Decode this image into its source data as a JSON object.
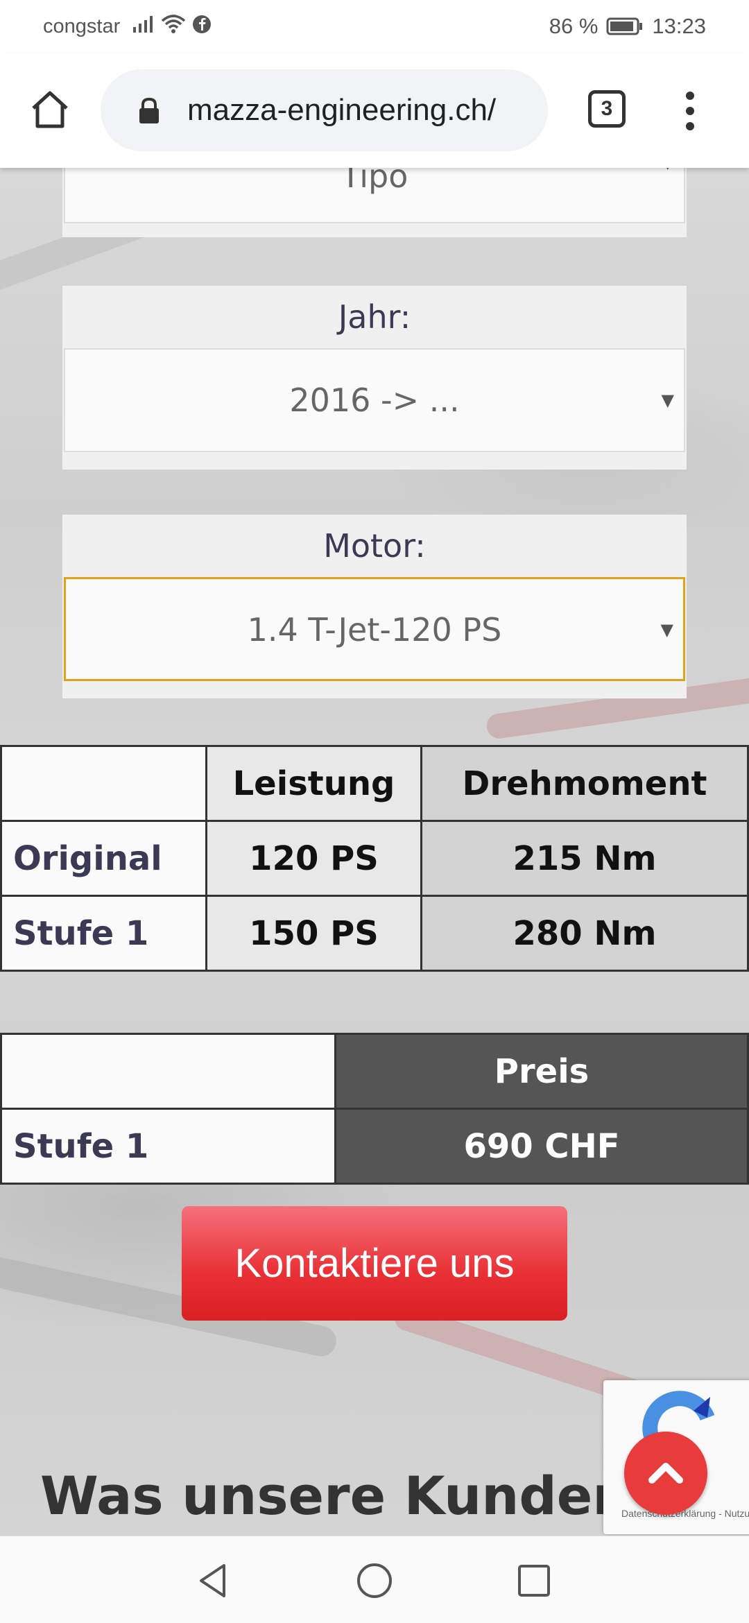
{
  "status_bar": {
    "carrier": "congstar",
    "battery": "86 %",
    "time": "13:23"
  },
  "browser": {
    "url": "mazza-engineering.ch/",
    "tab_count": "3"
  },
  "form": {
    "model_partial": "Tipo",
    "year_label": "Jahr:",
    "year_value": "2016 -> ...",
    "engine_label": "Motor:",
    "engine_value": "1.4 T-Jet-120 PS"
  },
  "specs_table": {
    "headers": [
      "",
      "Leistung",
      "Drehmoment"
    ],
    "rows": [
      {
        "label": "Original",
        "power": "120 PS",
        "torque": "215 Nm"
      },
      {
        "label": "Stufe 1",
        "power": "150 PS",
        "torque": "280 Nm"
      }
    ]
  },
  "price_table": {
    "header": "Preis",
    "row_label": "Stufe 1",
    "price": "690 CHF"
  },
  "cta": {
    "contact_label": "Kontaktiere uns"
  },
  "section": {
    "heading": "Was unsere Kunden über"
  },
  "recaptcha": {
    "text": "Datenschutzerklärung - Nutzungsbedingungen"
  },
  "colors": {
    "accent_red": "#e82f34",
    "label_navy": "#3b3954",
    "focus_orange": "#e0a31a",
    "price_dark": "#555555"
  },
  "icons": [
    "signal-icon",
    "wifi-icon",
    "facebook-icon",
    "battery-icon",
    "home-icon",
    "lock-icon",
    "tabs-icon",
    "overflow-menu-icon",
    "scroll-top-icon",
    "back-icon",
    "home-nav-icon",
    "recents-icon"
  ]
}
